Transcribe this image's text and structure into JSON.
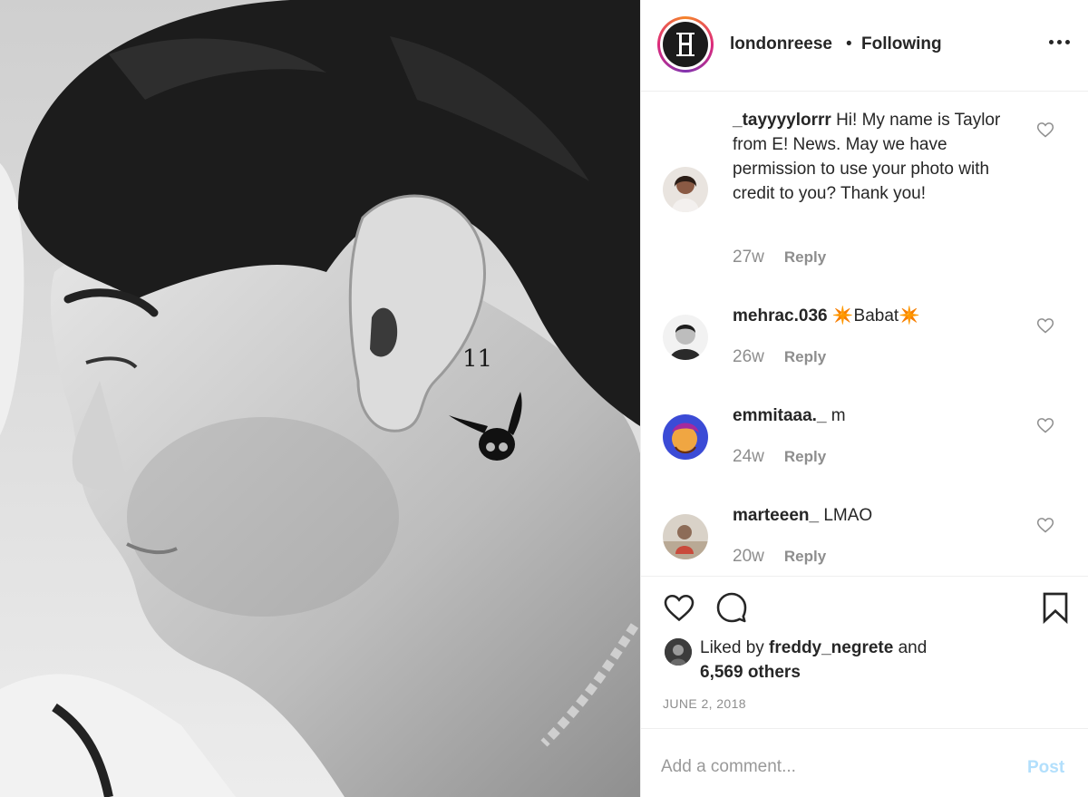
{
  "post": {
    "image_alt": "Black and white close-up of a man's profile with a small ear tattoo behind the ear"
  },
  "header": {
    "username": "londonreese",
    "separator": "•",
    "follow_state": "Following",
    "more_icon": "more-horizontal-icon"
  },
  "comments": [
    {
      "username": "_tayyyylorrr",
      "text": "Hi! My name is Taylor from E! News. May we have permission to use your photo with credit to you? Thank you!",
      "time": "27w",
      "reply": "Reply"
    },
    {
      "username": "mehrac.036",
      "text": "✴️Babat✴️",
      "time": "26w",
      "reply": "Reply"
    },
    {
      "username": "emmitaaa._",
      "text": "m",
      "time": "24w",
      "reply": "Reply"
    },
    {
      "username": "marteeen_",
      "text": "LMAO",
      "time": "20w",
      "reply": "Reply"
    }
  ],
  "actions": {
    "like_icon": "heart-icon",
    "comment_icon": "comment-bubble-icon",
    "save_icon": "bookmark-icon"
  },
  "likes": {
    "prefix": "Liked by ",
    "liker": "freddy_negrete",
    "and": " and",
    "others": "6,569 others"
  },
  "date": "JUNE 2, 2018",
  "add_comment": {
    "placeholder": "Add a comment...",
    "post_label": "Post"
  },
  "colors": {
    "text": "#262626",
    "muted": "#8e8e8e",
    "post_disabled": "#b2dffc",
    "border": "#efefef"
  }
}
